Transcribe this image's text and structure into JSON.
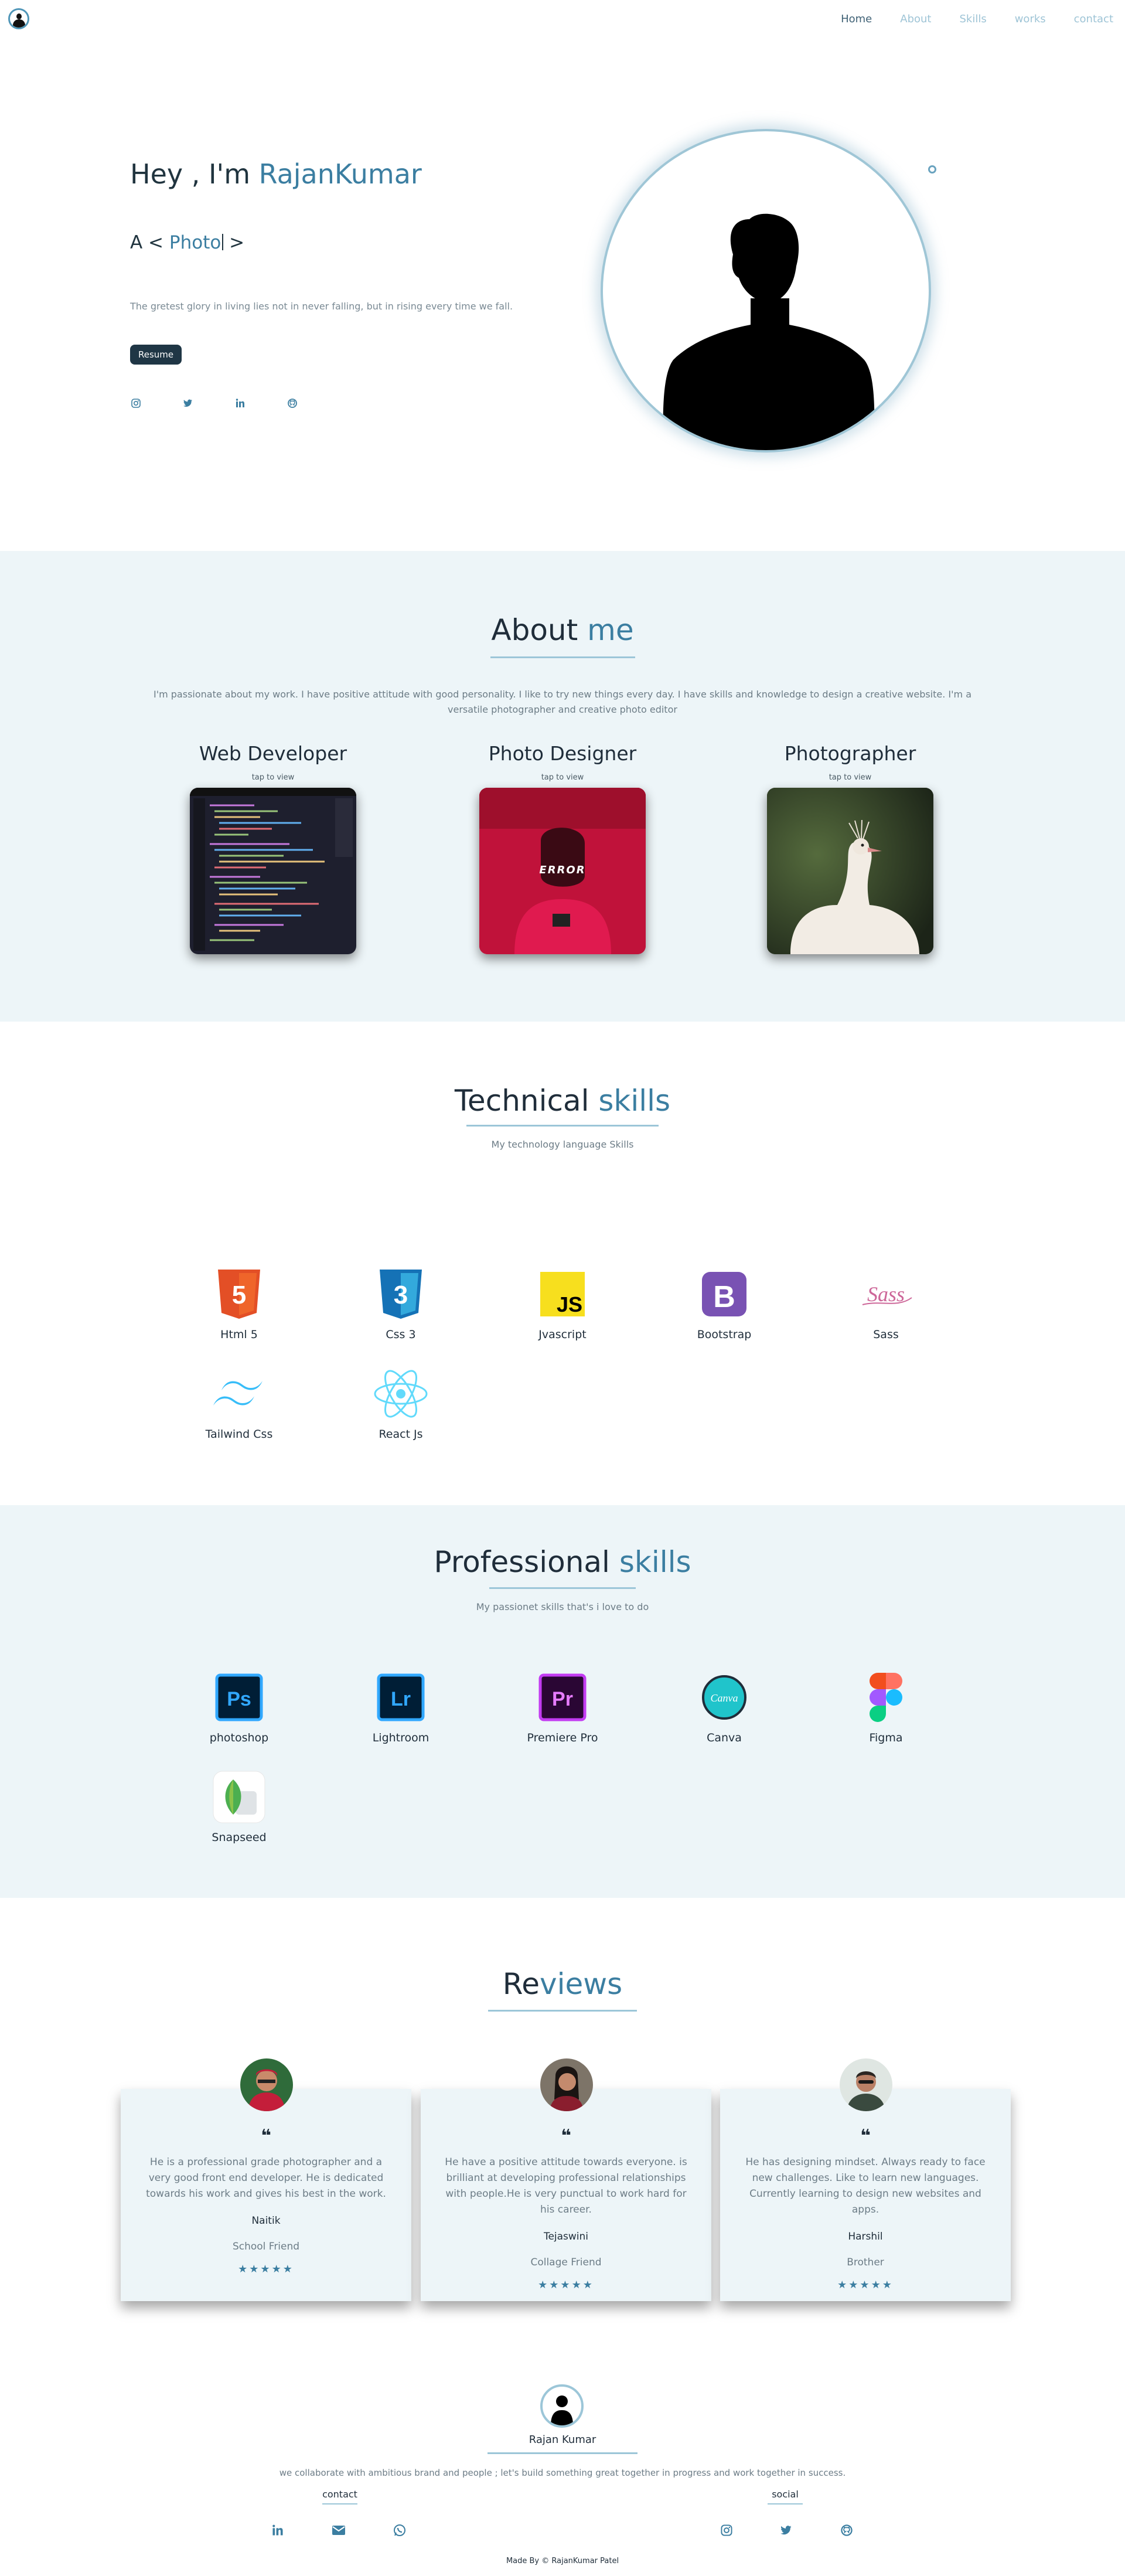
{
  "nav": {
    "links": [
      "Home",
      "About",
      "Skills",
      "works",
      "contact"
    ]
  },
  "hero": {
    "greeting_prefix": "Hey , I'm ",
    "name": "RajanKumar",
    "typed_prefix": "A < ",
    "typed_word": "Photo",
    "typed_suffix": " >",
    "quote": "The gretest glory in living lies not in never falling, but in rising every time we fall.",
    "resume_label": "Resume",
    "social_icons": [
      "instagram-icon",
      "twitter-icon",
      "linkedin-icon",
      "github-icon"
    ]
  },
  "about": {
    "title_a": "About ",
    "title_b": "me",
    "text": "I'm passionate about my work. I have positive attitude with good personality. I like to try new things every day. I have skills and knowledge to design a creative website. I'm a versatile photographer and creative photo editor",
    "cards": [
      {
        "title": "Web Developer",
        "tap": "tap to view"
      },
      {
        "title": "Photo Designer",
        "tap": "tap to view",
        "overlay": "ERROR"
      },
      {
        "title": "Photographer",
        "tap": "tap to view"
      }
    ]
  },
  "technical": {
    "title_a": "Technical ",
    "title_b": "skills",
    "subtitle": "My technology language Skills",
    "items": [
      {
        "label": "Html 5",
        "icon": "html5-icon",
        "glyph": "5"
      },
      {
        "label": "Css 3",
        "icon": "css3-icon",
        "glyph": "3"
      },
      {
        "label": "Jvascript",
        "icon": "javascript-icon",
        "glyph": "JS"
      },
      {
        "label": "Bootstrap",
        "icon": "bootstrap-icon",
        "glyph": "B"
      },
      {
        "label": "Sass",
        "icon": "sass-icon",
        "glyph": "Sass"
      },
      {
        "label": "Tailwind Css",
        "icon": "tailwind-icon",
        "glyph": ""
      },
      {
        "label": "React Js",
        "icon": "react-icon",
        "glyph": ""
      }
    ]
  },
  "professional": {
    "title_a": "Professional ",
    "title_b": "skills",
    "subtitle": "My passionet skills that's i love to do",
    "items": [
      {
        "label": "photoshop",
        "icon": "photoshop-icon",
        "glyph": "Ps"
      },
      {
        "label": "Lightroom",
        "icon": "lightroom-icon",
        "glyph": "Lr"
      },
      {
        "label": "Premiere Pro",
        "icon": "premiere-pro-icon",
        "glyph": "Pr"
      },
      {
        "label": "Canva",
        "icon": "canva-icon",
        "glyph": "Canva"
      },
      {
        "label": "Figma",
        "icon": "figma-icon",
        "glyph": ""
      },
      {
        "label": "Snapseed",
        "icon": "snapseed-icon",
        "glyph": ""
      }
    ]
  },
  "reviews": {
    "title_a": "Re",
    "title_b": "views",
    "items": [
      {
        "text": "He is a professional grade photographer and a very good front end developer. He is dedicated towards his work and gives his best in the work.",
        "name": "Naitik",
        "relation": "School Friend",
        "stars": "★★★★★"
      },
      {
        "text": "He have a positive attitude towards everyone. is brilliant at developing professional relationships with people.He is very punctual to work hard for his career.",
        "name": "Tejaswini",
        "relation": "Collage Friend",
        "stars": "★★★★★"
      },
      {
        "text": "He has designing mindset. Always ready to face new challenges. Like to learn new languages. Currently learning to design new websites and apps.",
        "name": "Harshil",
        "relation": "Brother",
        "stars": "★★★★★"
      }
    ]
  },
  "footer": {
    "name": "Rajan Kumar",
    "text": "we collaborate with ambitious brand and people ; let's build something great together in progress and work together in success.",
    "contact_heading": "contact",
    "social_heading": "social",
    "contact_icons": [
      "linkedin-icon",
      "mail-icon",
      "whatsapp-icon"
    ],
    "social_icons": [
      "instagram-icon",
      "twitter-icon",
      "github-icon"
    ],
    "copyright": "Made By © RajanKumar Patel"
  },
  "colors": {
    "accent": "#3b7ea1",
    "dark": "#1f2d3a",
    "section_bg": "#edf5f8"
  }
}
